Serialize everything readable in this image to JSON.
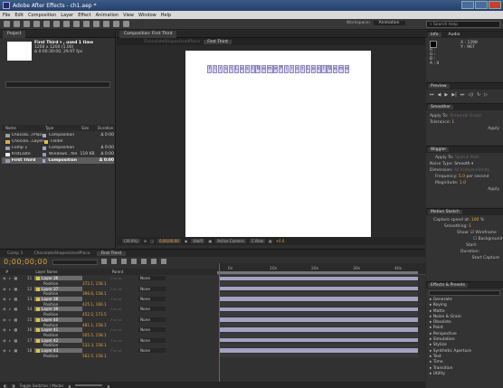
{
  "app": {
    "title": "Adobe After Effects - ch1.aep *",
    "menu": [
      "File",
      "Edit",
      "Composition",
      "Layer",
      "Effect",
      "Animation",
      "View",
      "Window",
      "Help"
    ],
    "workspace_label": "Workspace:",
    "workspace_value": "Animation",
    "search_placeholder": "Search Help"
  },
  "project": {
    "tab": "Project",
    "selected_name": "First Third ▾ , used 1 time",
    "selected_size": "1200 x 1200 (1.00)",
    "selected_duration": "Δ 0:00:30:00, 29.97 fps",
    "columns": [
      "Name",
      "Type",
      "Size",
      "Duration"
    ],
    "items": [
      {
        "name": "Chocola...rPlace",
        "type": "Composition",
        "size": "",
        "duration": "Δ 0:00",
        "selected": false
      },
      {
        "name": "Chocola...Layers",
        "type": "Folder",
        "size": "",
        "duration": "",
        "selected": false
      },
      {
        "name": "Comp 1",
        "type": "Composition",
        "size": "",
        "duration": "Δ 0:00",
        "selected": false
      },
      {
        "name": "firstLaste",
        "type": "Windows...file",
        "size": "119 KB",
        "duration": "Δ 0:00",
        "selected": false
      },
      {
        "name": "First Third",
        "type": "Composition",
        "size": "",
        "duration": "Δ 0:00",
        "selected": true
      }
    ],
    "footer_bpc": "8 bpc"
  },
  "composition": {
    "tab": "Composition: First Third",
    "crumb_prev": "ChocolateShapesUsedPlace",
    "crumb_active": "First Third",
    "letters": [
      "f",
      "i",
      "r",
      "s",
      "t",
      "L",
      "a",
      "s",
      "t",
      "N",
      "a",
      "m",
      "e",
      "F",
      "i",
      "r",
      "s",
      "t",
      "L",
      "a",
      "s",
      "t",
      "N",
      "a",
      "m",
      "e"
    ],
    "footer": {
      "zoom": "(39.9%)",
      "timecode": "0;00;00;00",
      "resolution": "(Half)",
      "camera": "Active Camera",
      "views": "1 View",
      "exposure": "+0.0"
    }
  },
  "info": {
    "tabs": [
      "Info",
      "Audio"
    ],
    "x": "X : 1298",
    "y": "Y : 967",
    "r": "R :",
    "g": "G :",
    "b": "B :",
    "a": "A : 0"
  },
  "preview": {
    "tab": "Preview"
  },
  "smoother": {
    "tab": "Smoother",
    "apply_to_label": "Apply To:",
    "apply_to_value": "Temporal Graph",
    "tolerance_label": "Tolerance:",
    "tolerance_value": "1",
    "apply_btn": "Apply"
  },
  "wiggler": {
    "tab": "Wiggler",
    "apply_to_label": "Apply To:",
    "apply_to_value": "Spatial Path",
    "noise_type_label": "Noise Type:",
    "noise_type_value": "Smooth",
    "dimension_label": "Dimension:",
    "dimension_value": "All Independently",
    "frequency_label": "Frequency:",
    "frequency_value": "5.0",
    "frequency_unit": "per second",
    "magnitude_label": "Magnitude:",
    "magnitude_value": "1.0",
    "apply_btn": "Apply"
  },
  "motion_sketch": {
    "tab": "Motion Sketch",
    "capture_label": "Capture speed at:",
    "capture_value": "100",
    "capture_unit": "%",
    "smoothing_label": "Smoothing:",
    "smoothing_value": "1",
    "show_label": "Show:",
    "wireframe": "Wireframe",
    "background": "Background",
    "start_label": "Start:",
    "duration_label": "Duration:",
    "start_capture_btn": "Start Capture"
  },
  "effects": {
    "tab": "Effects & Presets",
    "items": [
      "▸ Generate",
      "▸ Keying",
      "▸ Matte",
      "▸ Noise & Grain",
      "▸ Obsolete",
      "▸ Paint",
      "▸ Perspective",
      "▸ Simulation",
      "▸ Stylize",
      "▸ Synthetic Aperture",
      "▸ Text",
      "▸ Time",
      "▸ Transition",
      "▸ Utility"
    ]
  },
  "timeline": {
    "tabs": [
      "Comp 1",
      "ChocolateShapesUsedPlace",
      "First Third"
    ],
    "active_tab_index": 2,
    "timecode": "0;00;00;00",
    "columns": [
      "#",
      "Layer Name",
      "Parent"
    ],
    "ruler": [
      "0s",
      "10s",
      "20s",
      "30s",
      "40s"
    ],
    "layers": [
      {
        "num": "11",
        "name": "Layer 36",
        "pos": "372.1, 158.1"
      },
      {
        "num": "12",
        "name": "Layer 37",
        "pos": "396.6, 158.1"
      },
      {
        "num": "13",
        "name": "Layer 38",
        "pos": "425.1, 160.1"
      },
      {
        "num": "14",
        "name": "Layer 39",
        "pos": "452.2, 173.5"
      },
      {
        "num": "15",
        "name": "Layer 40",
        "pos": "481.1, 158.1"
      },
      {
        "num": "16",
        "name": "Layer 41",
        "pos": "505.5, 158.1"
      },
      {
        "num": "17",
        "name": "Layer 42",
        "pos": "532.3, 158.1"
      },
      {
        "num": "18",
        "name": "Layer 43",
        "pos": "562.5, 158.1"
      }
    ],
    "position_label": "Position",
    "parent_value": "None",
    "footer_toggle": "Toggle Switches / Modes"
  }
}
